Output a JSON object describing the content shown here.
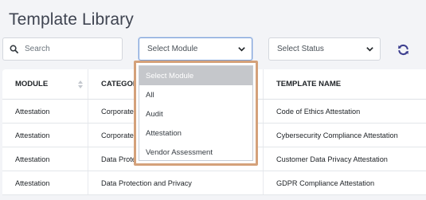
{
  "page": {
    "title": "Template Library"
  },
  "filters": {
    "search_placeholder": "Search",
    "module_select": "Select Module",
    "status_select": "Select Status"
  },
  "icons": {
    "search": "search-icon",
    "chevron": "chevron-down-icon",
    "refresh": "refresh-icon",
    "sort": "sort-icon"
  },
  "colors": {
    "accent": "#3d3f8f",
    "highlight_border": "#d4a17a",
    "selected_option": "#c5c7cb"
  },
  "table": {
    "headers": [
      "MODULE",
      "CATEGORY",
      "TEMPLATE NAME"
    ],
    "rows": [
      [
        "Attestation",
        "Corporate Compliance",
        "Code of Ethics Attestation"
      ],
      [
        "Attestation",
        "Corporate Compliance",
        "Cybersecurity Compliance Attestation"
      ],
      [
        "Attestation",
        "Data Protection and Privacy",
        "Customer Data Privacy Attestation"
      ],
      [
        "Attestation",
        "Data Protection and Privacy",
        "GDPR Compliance Attestation"
      ]
    ]
  },
  "dropdown": {
    "options": [
      "Select Module",
      "All",
      "Audit",
      "Attestation",
      "Vendor Assessment"
    ],
    "selected_index": 0
  }
}
